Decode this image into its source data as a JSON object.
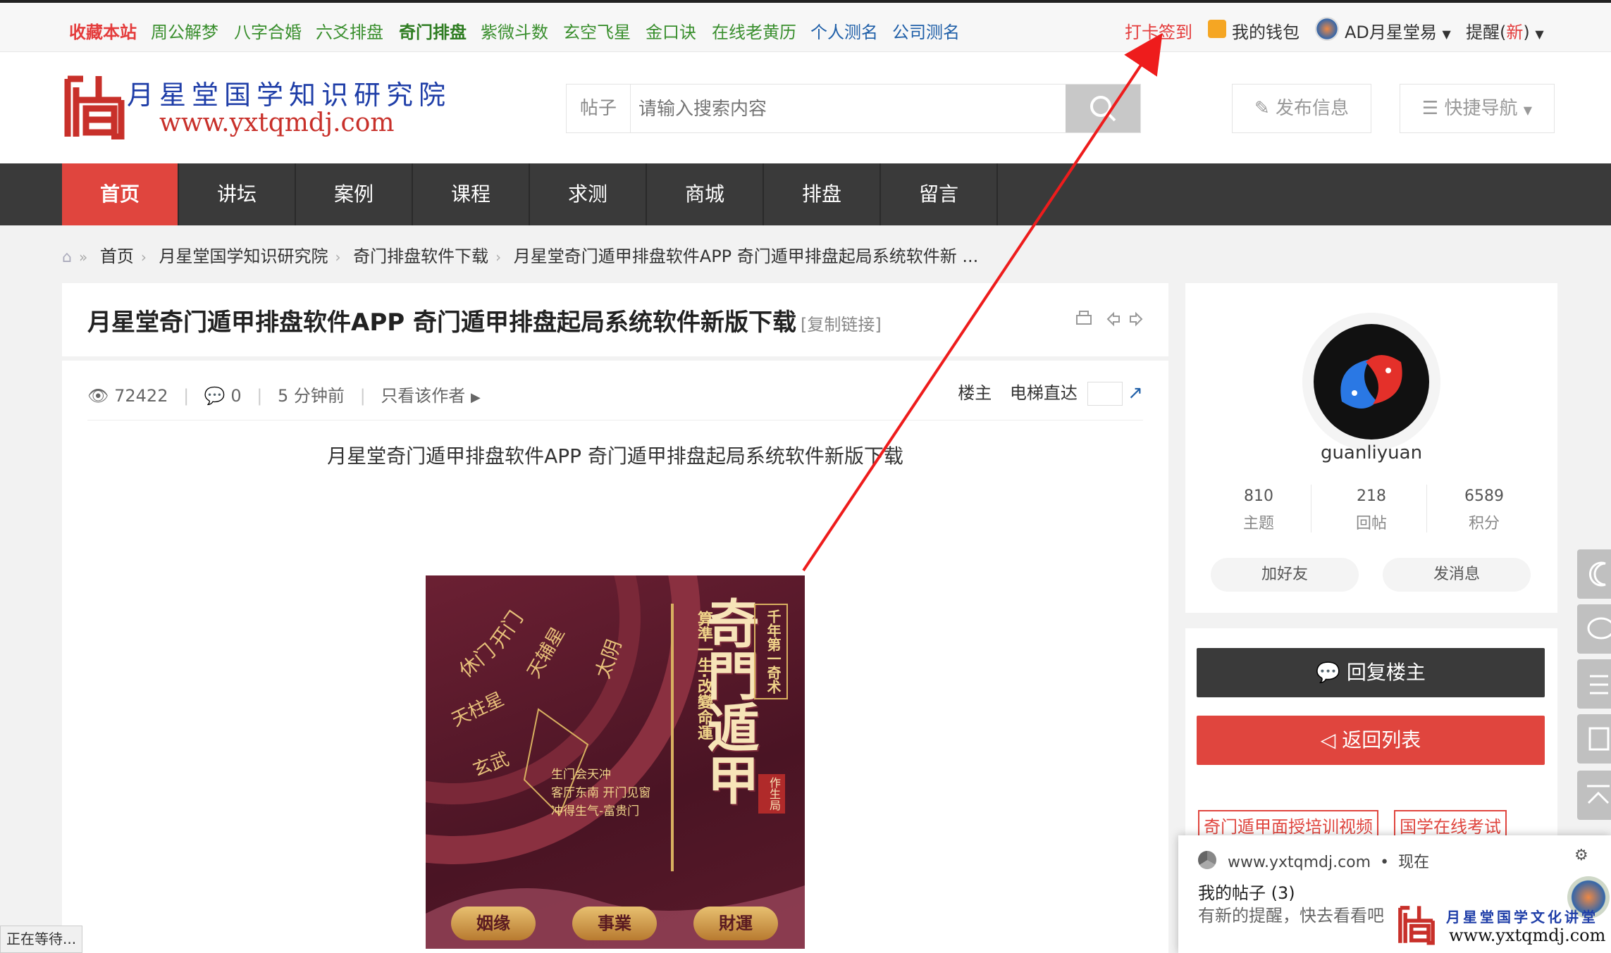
{
  "topbar": {
    "left_links": [
      "收藏本站",
      "周公解梦",
      "八字合婚",
      "六爻排盘",
      "奇门排盘",
      "紫微斗数",
      "玄空飞星",
      "金口诀",
      "在线老黄历",
      "个人测名",
      "公司测名"
    ],
    "checkin": "打卡签到",
    "wallet": "我的钱包",
    "user": "AD月星堂易",
    "remind_prefix": "提醒(",
    "remind_new": "新",
    "remind_suffix": ")"
  },
  "header": {
    "site_name": "月星堂国学知识研究院",
    "site_url": "www.yxtqmdj.com",
    "search_type": "帖子",
    "search_placeholder": "请输入搜索内容",
    "publish": "发布信息",
    "quicknav": "快捷导航"
  },
  "nav": [
    "首页",
    "讲坛",
    "案例",
    "课程",
    "求测",
    "商城",
    "排盘",
    "留言"
  ],
  "breadcrumb": [
    "首页",
    "月星堂国学知识研究院",
    "奇门排盘软件下载",
    "月星堂奇门遁甲排盘软件APP 奇门遁甲排盘起局系统软件新 ..."
  ],
  "post": {
    "title": "月星堂奇门遁甲排盘软件APP 奇门遁甲排盘起局系统软件新版下载",
    "copy_link": "[复制链接]",
    "views": "72422",
    "replies": "0",
    "time": "5 分钟前",
    "only_author": "只看该作者",
    "floor": "楼主",
    "elevator": "电梯直达",
    "body_title": "月星堂奇门遁甲排盘软件APP 奇门遁甲排盘起局系统软件新版下载"
  },
  "poster": {
    "title": "奇門遁甲",
    "subtitle1": "千年第一奇术",
    "subtitle2": "算準一生·改變命運",
    "seal": "作生局",
    "caption": [
      "生门会天冲",
      "客厅东南 开门见窗",
      "冲得生气-富贵门"
    ],
    "ring_words": [
      "休门",
      "开门",
      "天辅星",
      "天柱星",
      "玄武",
      "太阴"
    ],
    "buttons": [
      "姻缘",
      "事業",
      "財運"
    ]
  },
  "profile": {
    "username": "guanliyuan",
    "stats": [
      {
        "value": "810",
        "label": "主题"
      },
      {
        "value": "218",
        "label": "回帖"
      },
      {
        "value": "6589",
        "label": "积分"
      }
    ],
    "add_friend": "加好友",
    "message": "发消息"
  },
  "actions": {
    "reply": "回复楼主",
    "back": "返回列表",
    "tags": [
      "奇门遁甲面授培训视频",
      "国学在线考试"
    ]
  },
  "notification": {
    "site": "www.yxtqmdj.com",
    "time": "现在",
    "title": "我的帖子 (3)",
    "text": "有新的提醒，快去看看吧"
  },
  "watermark": {
    "name": "月星堂国学文化讲堂",
    "url": "www.yxtqmdj.com"
  },
  "status": "正在等待...",
  "colors": {
    "accent": "#e0453e",
    "nav": "#3a3a3a",
    "green_link": "#3a8f2e",
    "annotation": "#ee1c1c"
  }
}
